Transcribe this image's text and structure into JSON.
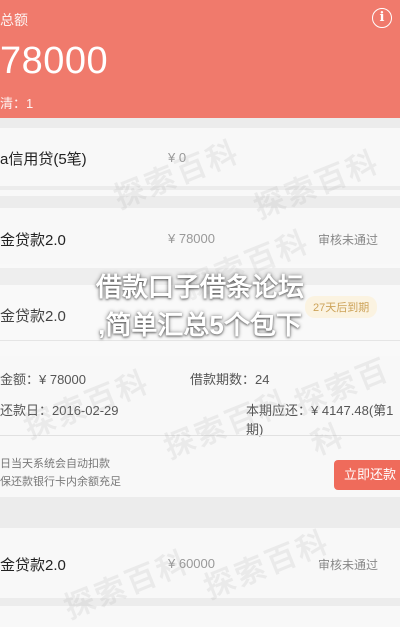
{
  "header": {
    "total_label": "总额",
    "total_amount": "78000",
    "pending_label": "清：1",
    "info_icon": "info-icon"
  },
  "loans": [
    {
      "name": "a信用贷(5笔)",
      "amount": "¥ 0",
      "status": ""
    },
    {
      "name": "金贷款2.0",
      "amount": "¥ 78000",
      "status": "审核未通过"
    },
    {
      "name": "金贷款2.0",
      "amount": "",
      "status": "27天后到期"
    },
    {
      "name": "金贷款2.0",
      "amount": "¥ 60000",
      "status": "审核未通过"
    }
  ],
  "detail": {
    "amount_label": "金额：¥ 78000",
    "term_label": "借款期数：24",
    "date_label": "还款日：2016-02-29",
    "due_label": "本期应还：¥ 4147.48(第1期)"
  },
  "notice": {
    "line1": "日当天系统会自动扣款",
    "line2": "保还款银行卡内余额充足"
  },
  "repay_button": "立即还款",
  "overlay": {
    "line1": "借款口子借条论坛",
    "line2": ",简单汇总5个包下"
  },
  "watermark_text": "探索百科",
  "colors": {
    "accent": "#f07a6c",
    "button": "#ef6b5b",
    "overdue": "#c4933c"
  }
}
